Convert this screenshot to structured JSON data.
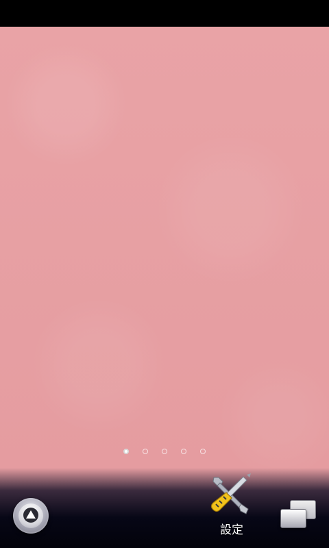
{
  "status_bar": {},
  "home": {
    "page_indicator": {
      "count": 5,
      "active_index": 0
    },
    "dock": {
      "launcher_icon": "app-drawer-up-arrow-icon",
      "shortcut": {
        "label": "設定",
        "icon": "settings-wrench-screwdriver-icon"
      },
      "recent_apps_icon": "recent-windows-icon"
    }
  },
  "colors": {
    "wallpaper": "#e9a3a6",
    "dock": "#070716",
    "accent_white": "#ffffff"
  }
}
